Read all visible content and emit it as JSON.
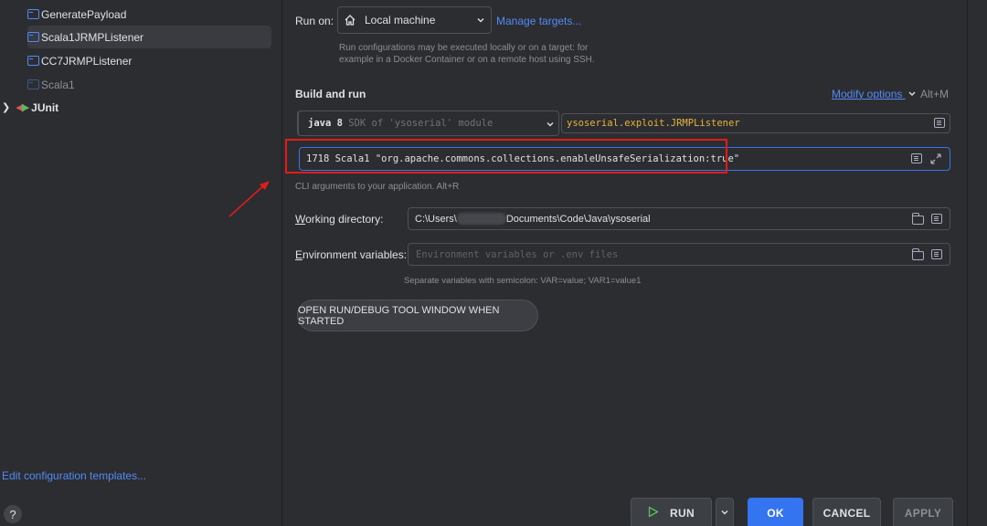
{
  "sidebar": {
    "items": [
      {
        "label": "GeneratePayload"
      },
      {
        "label": "Scala1JRMPListener"
      },
      {
        "label": "CC7JRMPListener"
      },
      {
        "label": "Scala1"
      },
      {
        "label": "JUnit"
      }
    ],
    "edit_templates": "Edit configuration templates...",
    "help": "?"
  },
  "run_on": {
    "label": "Run on:",
    "value": "Local machine",
    "manage_targets": "Manage targets...",
    "hint_line1": "Run configurations may be executed locally or on a target: for",
    "hint_line2": "example in a Docker Container or on a remote host using SSH."
  },
  "build_and_run": {
    "heading": "Build and run",
    "modify_options": "Modify options",
    "modify_shortcut": "Alt+M",
    "jdk_bold": "java 8",
    "jdk_rest": " SDK of 'ysoserial' module",
    "main_class": "ysoserial.exploit.JRMPListener",
    "program_args": "1718 Scala1 \"org.apache.commons.collections.enableUnsafeSerialization:true\"",
    "args_hint": "CLI arguments to your application. Alt+R"
  },
  "working_directory": {
    "label": "Working directory:",
    "value_start": "C:\\Users\\",
    "value_end": "Documents\\Code\\Java\\ysoserial"
  },
  "environment": {
    "label": "Environment variables:",
    "placeholder": "Environment variables or .env files",
    "hint": "Separate variables with semicolon: VAR=value; VAR1=value1"
  },
  "open_tool_window": "OPEN RUN/DEBUG TOOL WINDOW WHEN STARTED",
  "footer": {
    "run": "RUN",
    "ok": "OK",
    "cancel": "CANCEL",
    "apply": "APPLY"
  },
  "colors": {
    "accent": "#3574f0",
    "link": "#548af7",
    "highlight": "#e21b1b",
    "background": "#2b2d30"
  }
}
